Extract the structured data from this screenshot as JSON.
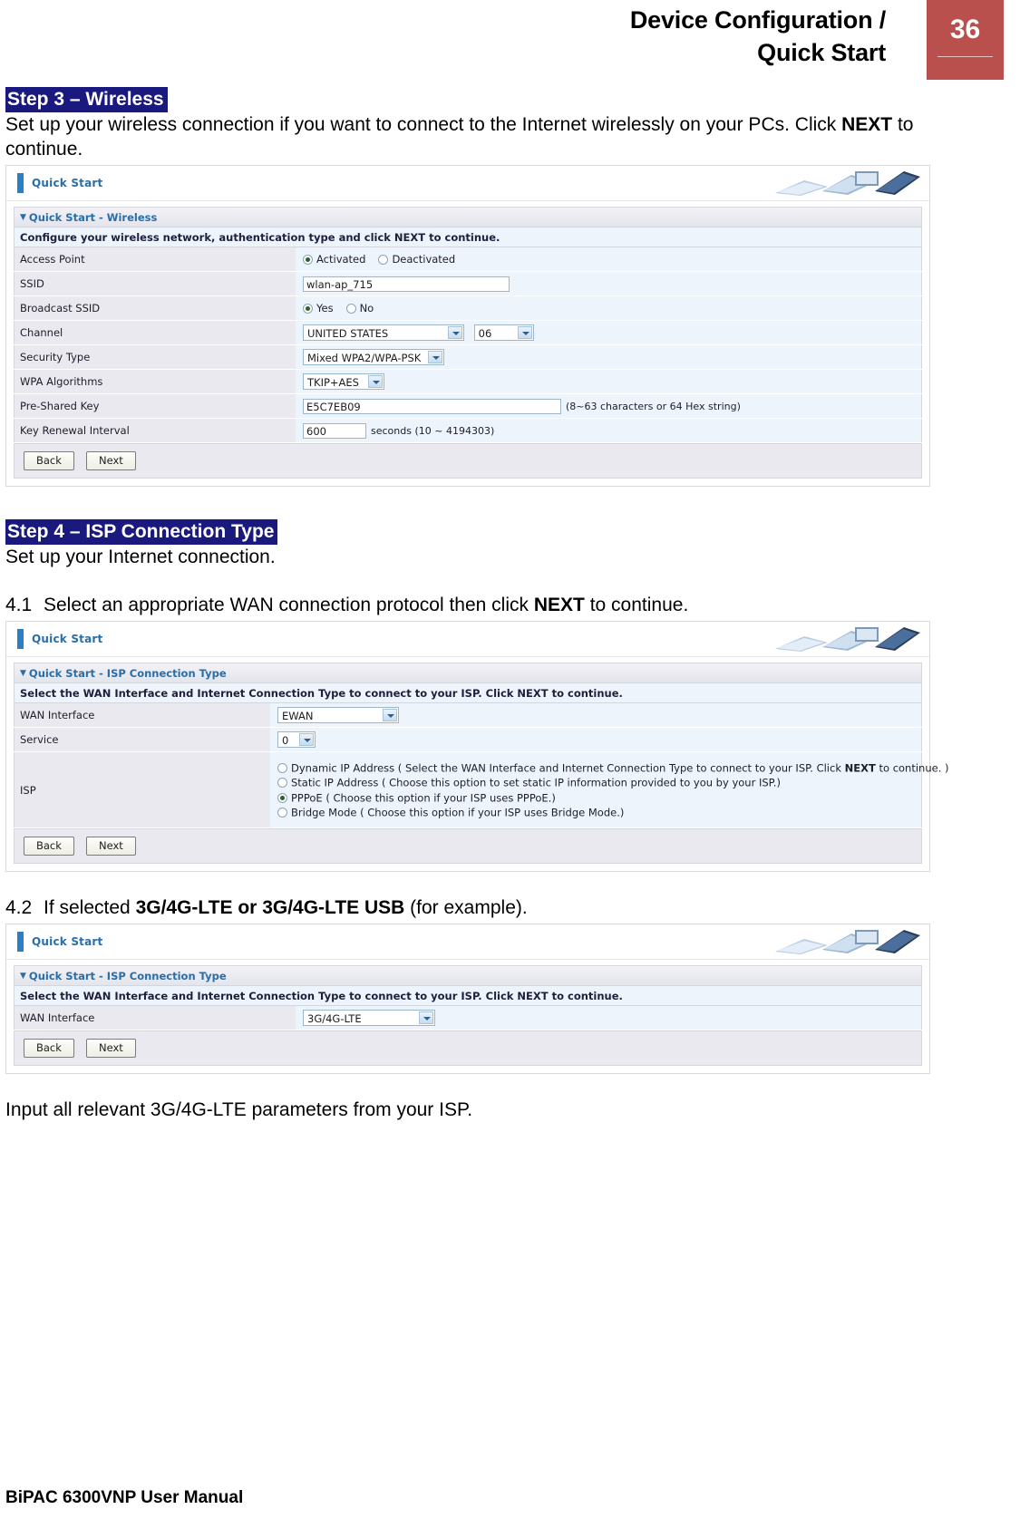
{
  "header": {
    "title_line1": "Device Configuration /",
    "title_line2": "Quick Start",
    "page_number": "36",
    "accent_color": "#b9504e"
  },
  "highlight_color": "#1a1a7e",
  "sections": {
    "step3": {
      "heading": "Step 3 – Wireless",
      "body_pre": "Set up your wireless connection if you want to connect to the Internet wirelessly on your PCs. Click ",
      "body_bold": "NEXT",
      "body_post": " to continue."
    },
    "step4": {
      "heading": "Step 4 – ISP Connection Type",
      "body": "Set up your Internet connection."
    },
    "item41": {
      "index": "4.1",
      "text_pre": "Select an appropriate WAN connection protocol then click ",
      "text_bold": "NEXT",
      "text_post": " to continue."
    },
    "item42": {
      "index": "4.2",
      "text_pre": "If selected ",
      "text_bold": "3G/4G-LTE or 3G/4G-LTE USB",
      "text_post": " (for example)."
    },
    "closing": "Input all relevant 3G/4G-LTE parameters from your ISP."
  },
  "screenshot_wireless": {
    "window_title": "Quick Start",
    "section_title": "Quick Start - Wireless",
    "section_desc": "Configure your wireless network, authentication type and click NEXT to continue.",
    "rows": [
      {
        "label": "Access Point",
        "type": "radio-pair",
        "options": [
          "Activated",
          "Deactivated"
        ],
        "selected": "Activated"
      },
      {
        "label": "SSID",
        "type": "text",
        "value": "wlan-ap_715"
      },
      {
        "label": "Broadcast SSID",
        "type": "radio-pair",
        "options": [
          "Yes",
          "No"
        ],
        "selected": "Yes"
      },
      {
        "label": "Channel",
        "type": "select-pair",
        "value": "UNITED STATES",
        "value2": "06"
      },
      {
        "label": "Security Type",
        "type": "select",
        "value": "Mixed WPA2/WPA-PSK"
      },
      {
        "label": "WPA Algorithms",
        "type": "select",
        "value": "TKIP+AES"
      },
      {
        "label": "Pre-Shared Key",
        "type": "text-hint",
        "value": "E5C7EB09",
        "hint": "(8~63 characters or 64 Hex string)"
      },
      {
        "label": "Key Renewal Interval",
        "type": "text-hint",
        "value": "600",
        "hint": "seconds  (10 ~ 4194303)"
      }
    ],
    "buttons": {
      "back": "Back",
      "next": "Next"
    }
  },
  "screenshot_isp": {
    "window_title": "Quick Start",
    "section_title": "Quick Start - ISP Connection Type",
    "section_desc": "Select the WAN Interface and Internet Connection Type to connect to your ISP. Click NEXT to continue.",
    "rows": [
      {
        "label": "WAN Interface",
        "type": "select",
        "value": "EWAN"
      },
      {
        "label": "Service",
        "type": "select-small",
        "value": "0"
      }
    ],
    "isp_label": "ISP",
    "isp_options": [
      {
        "text": "Dynamic IP Address ( Select the WAN Interface and Internet Connection Type to connect to your ISP. Click ",
        "bold": "NEXT",
        "text_post": " to continue. )",
        "selected": false
      },
      {
        "text": "Static IP Address ( Choose this option to set static IP information provided to you by your ISP.)",
        "bold": "",
        "text_post": "",
        "selected": false
      },
      {
        "text": "PPPoE ( Choose this option if your ISP uses PPPoE.)",
        "bold": "",
        "text_post": "",
        "selected": true
      },
      {
        "text": "Bridge Mode ( Choose this option if your ISP uses Bridge Mode.)",
        "bold": "",
        "text_post": "",
        "selected": false
      }
    ],
    "buttons": {
      "back": "Back",
      "next": "Next"
    }
  },
  "screenshot_lte": {
    "window_title": "Quick Start",
    "section_title": "Quick Start - ISP Connection Type",
    "section_desc": "Select the WAN Interface and Internet Connection Type to connect to your ISP. Click NEXT to continue.",
    "rows": [
      {
        "label": "WAN Interface",
        "type": "select",
        "value": "3G/4G-LTE"
      }
    ],
    "buttons": {
      "back": "Back",
      "next": "Next"
    }
  },
  "footer": {
    "text": "BiPAC 6300VNP User Manual"
  }
}
